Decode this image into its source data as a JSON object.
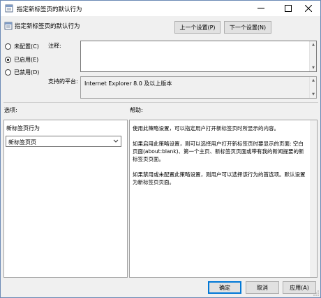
{
  "window": {
    "title": "指定新标签页的默认行为",
    "minimize_glyph": "—",
    "maximize_glyph": "☐",
    "close_glyph": "✕"
  },
  "header": {
    "policy_name": "指定新标签页的默认行为",
    "prev_label": "上一个设置(P)",
    "next_label": "下一个设置(N)"
  },
  "state": {
    "options": [
      {
        "label": "未配置(C)",
        "checked": false
      },
      {
        "label": "已启用(E)",
        "checked": true
      },
      {
        "label": "已禁用(D)",
        "checked": false
      }
    ]
  },
  "comment": {
    "label": "注释:",
    "value": ""
  },
  "platform": {
    "label": "支持的平台:",
    "value": "Internet Explorer 8.0 及以上版本"
  },
  "options_section": {
    "label": "选项:",
    "setting_title": "新标签页行为",
    "dropdown_value": "新标签页页"
  },
  "help_section": {
    "label": "帮助:",
    "paragraphs": [
      "使用此策略设置，可以指定用户打开新标签页时所显示的内容。",
      "如果启用此策略设置，则可以选择用户打开新标签页时要显示的页面: 空白页面(about:blank)、第一个主页、新标签页页面或带有我的新闻提要的新标签页页面。",
      "如果禁用或未配置此策略设置，则用户可以选择该行为的首选项。默认设置为新标签页页面。"
    ]
  },
  "footer": {
    "ok_label": "确定",
    "cancel_label": "取消",
    "apply_label": "应用(A)"
  },
  "colors": {
    "accent": "#0078d7",
    "window_bg": "#f0f0f0"
  }
}
